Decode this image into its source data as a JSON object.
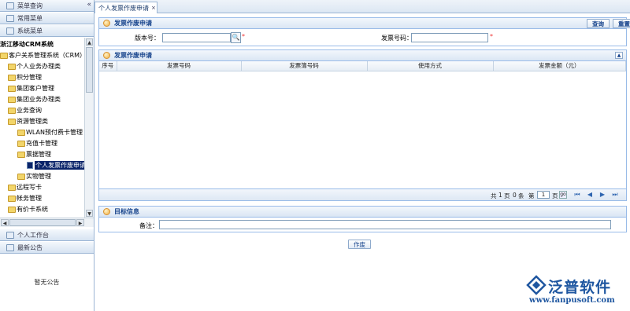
{
  "left": {
    "menus": [
      {
        "label": "菜单查询",
        "icon": "search-icon"
      },
      {
        "label": "常用菜单",
        "icon": "list-icon"
      },
      {
        "label": "系统菜单",
        "icon": "folder-icon"
      }
    ],
    "tree": [
      {
        "label": "浙江移动CRM系统",
        "level": 0,
        "type": "root"
      },
      {
        "label": "客户关系管理系统（CRM）",
        "level": 0,
        "type": "folder"
      },
      {
        "label": "个人业务办理类",
        "level": 1,
        "type": "folder"
      },
      {
        "label": "积分管理",
        "level": 1,
        "type": "folder"
      },
      {
        "label": "集团客户管理",
        "level": 1,
        "type": "folder"
      },
      {
        "label": "集团业务办理类",
        "level": 1,
        "type": "folder"
      },
      {
        "label": "业务查询",
        "level": 1,
        "type": "folder"
      },
      {
        "label": "资源管理类",
        "level": 1,
        "type": "folder"
      },
      {
        "label": "WLAN预付费卡管理",
        "level": 2,
        "type": "folder"
      },
      {
        "label": "充值卡管理",
        "level": 2,
        "type": "folder"
      },
      {
        "label": "票据管理",
        "level": 2,
        "type": "folder"
      },
      {
        "label": "个人发票作废申请",
        "level": 3,
        "type": "page",
        "selected": true
      },
      {
        "label": "实物管理",
        "level": 2,
        "type": "folder"
      },
      {
        "label": "远程写卡",
        "level": 1,
        "type": "folder"
      },
      {
        "label": "帐务管理",
        "level": 1,
        "type": "folder"
      },
      {
        "label": "有价卡系统",
        "level": 1,
        "type": "folder"
      }
    ],
    "bottom_menus": [
      {
        "label": "个人工作台",
        "icon": "desk-icon"
      },
      {
        "label": "最新公告",
        "icon": "bell-icon"
      }
    ],
    "notice_text": "暂无公告"
  },
  "tab": {
    "label": "个人发票作废申请",
    "close": "×"
  },
  "search_panel": {
    "title": "发票作废申请",
    "query_label": "查询",
    "reset_label": "重置",
    "version_label": "版本号：",
    "version_value": "",
    "invoice_label": "发票号码：",
    "invoice_value": "",
    "required_mark": "*"
  },
  "grid_panel": {
    "title": "发票作废申请",
    "columns": [
      "序号",
      "发票号码",
      "发票簿号码",
      "使用方式",
      "发票金额（元）"
    ],
    "rows": [],
    "pager": {
      "total_prefix": "共",
      "total_pages": "1",
      "page_unit": "页",
      "record_count": "0",
      "record_unit": "条",
      "page_prefix": "第",
      "current_page": "1",
      "page_suffix": "页",
      "go": "go"
    }
  },
  "target_panel": {
    "title": "目标信息",
    "remark_label": "备注：",
    "remark_value": ""
  },
  "submit_label": "作废",
  "logo": {
    "name": "泛普软件",
    "url": "www.fanpusoft.com"
  }
}
